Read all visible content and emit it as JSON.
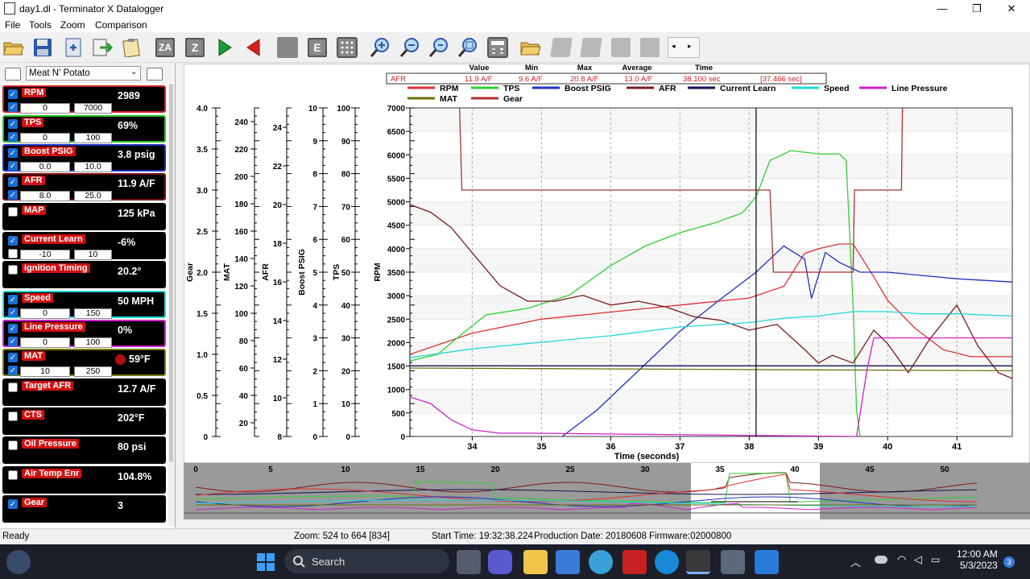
{
  "window": {
    "title": "day1.dl - Terminator X Datalogger",
    "minimize": "—",
    "maximize": "❐",
    "close": "✕"
  },
  "menu": [
    {
      "label": "File"
    },
    {
      "label": "Tools"
    },
    {
      "label": "Zoom"
    },
    {
      "label": "Comparison"
    }
  ],
  "toolbar": {
    "za_label": "ZA",
    "z_label": "Z",
    "e_label": "E"
  },
  "profile": {
    "selected": "Meat N' Potato"
  },
  "channels": [
    {
      "label": "RPM",
      "value": "2989",
      "min": "0",
      "max": "7000",
      "checked": true,
      "bordercolor": "#d02020"
    },
    {
      "label": "TPS",
      "value": "69%",
      "min": "0",
      "max": "100",
      "checked": true,
      "bordercolor": "#22c422"
    },
    {
      "label": "Boost PSIG",
      "value": "3.8 psig",
      "min": "0.0",
      "max": "10.0",
      "checked": true,
      "bordercolor": "#2030c0"
    },
    {
      "label": "AFR",
      "value": "11.9 A/F",
      "min": "8.0",
      "max": "25.0",
      "checked": true,
      "bordercolor": "#7a1010"
    },
    {
      "label": "MAP",
      "value": "125 kPa",
      "checked": false,
      "bordercolor": "#000000"
    },
    {
      "label": "Current Learn",
      "value": "-6%",
      "min": "-10",
      "max": "10",
      "checked": true,
      "bordercolor": "#000000"
    },
    {
      "label": "Ignition Timing",
      "value": "20.2°",
      "checked": false,
      "bordercolor": "#000000"
    },
    {
      "label": "Speed",
      "value": "50 MPH",
      "min": "0",
      "max": "150",
      "checked": true,
      "bordercolor": "#20d8d8"
    },
    {
      "label": "Line Pressure",
      "value": "0%",
      "min": "0",
      "max": "100",
      "checked": true,
      "bordercolor": "#d020d0"
    },
    {
      "label": "MAT",
      "value": "59°F",
      "min": "10",
      "max": "250",
      "checked": true,
      "bordercolor": "#7a7a10"
    },
    {
      "label": "Target AFR",
      "value": "12.7 A/F",
      "checked": false,
      "bordercolor": "#000000"
    },
    {
      "label": "CTS",
      "value": "202°F",
      "checked": false,
      "bordercolor": "#000000"
    },
    {
      "label": "Oil Pressure",
      "value": "80 psi",
      "checked": false,
      "bordercolor": "#000000"
    },
    {
      "label": "Air Temp Enr",
      "value": "104.8%",
      "checked": false,
      "bordercolor": "#000000"
    },
    {
      "label": "Gear",
      "value": "3",
      "checked": true,
      "bordercolor": "#000000"
    }
  ],
  "stats": {
    "headers": [
      "Value",
      "Min",
      "Max",
      "Average",
      "Time"
    ],
    "row": {
      "channel": "AFR",
      "value": "11.9 A/F",
      "min": "9.6 A/F",
      "max": "20.8 A/F",
      "average": "13.0 A/F",
      "time": "38.100 sec",
      "extra": "[37.466 sec]"
    }
  },
  "legend": [
    {
      "name": "RPM",
      "color": "#e03030"
    },
    {
      "name": "TPS",
      "color": "#30d030"
    },
    {
      "name": "Boost PSIG",
      "color": "#2030c0"
    },
    {
      "name": "AFR",
      "color": "#7a1a1a"
    },
    {
      "name": "Current Learn",
      "color": "#101050"
    },
    {
      "name": "Speed",
      "color": "#20d8d8"
    },
    {
      "name": "Line Pressure",
      "color": "#d020d0"
    },
    {
      "name": "MAT",
      "color": "#707010"
    },
    {
      "name": "Gear",
      "color": "#b03030"
    }
  ],
  "axes": {
    "gear": {
      "label": "Gear",
      "ticks": [
        "4.0",
        "3.5",
        "3.0",
        "2.5",
        "2.0",
        "1.5",
        "1.0",
        "0.5",
        "0"
      ]
    },
    "mat": {
      "label": "MAT",
      "ticks": [
        "240",
        "220",
        "200",
        "180",
        "160",
        "140",
        "120",
        "100",
        "80",
        "60",
        "40",
        "20"
      ]
    },
    "afr": {
      "label": "AFR",
      "ticks": [
        "24",
        "22",
        "20",
        "18",
        "16",
        "14",
        "12",
        "10",
        "8"
      ]
    },
    "boost": {
      "label": "Boost PSIG",
      "ticks": [
        "10",
        "9",
        "8",
        "7",
        "6",
        "5",
        "4",
        "3",
        "2",
        "1",
        "0"
      ]
    },
    "tps": {
      "label": "TPS",
      "ticks": [
        "100",
        "90",
        "80",
        "70",
        "60",
        "50",
        "40",
        "30",
        "20",
        "10",
        "0"
      ]
    },
    "rpm": {
      "label": "RPM",
      "ticks": [
        "7000",
        "6500",
        "6000",
        "5500",
        "5000",
        "4500",
        "4000",
        "3500",
        "3000",
        "2500",
        "2000",
        "1500",
        "1000",
        "500",
        "0"
      ]
    },
    "time": {
      "label": "Time (seconds)",
      "ticks": [
        "34",
        "35",
        "36",
        "37",
        "38",
        "39",
        "40",
        "41"
      ]
    }
  },
  "chart_data": {
    "type": "line",
    "xlabel": "Time (seconds)",
    "xlim": [
      33.1,
      41.8
    ],
    "cursor_x": 38.1,
    "series": [
      {
        "name": "RPM",
        "color": "#e03030",
        "units": "RPM",
        "ylim": [
          0,
          7000
        ],
        "x": [
          33.1,
          34,
          35,
          36,
          37,
          38,
          38.5,
          38.8,
          39,
          39.3,
          39.5,
          39.8,
          40,
          40.4,
          40.8,
          41.2,
          41.8
        ],
        "y": [
          1750,
          2200,
          2500,
          2650,
          2800,
          2950,
          3200,
          3900,
          4000,
          4100,
          4100,
          3400,
          2900,
          2300,
          1850,
          1700,
          1700
        ]
      },
      {
        "name": "TPS",
        "color": "#30d030",
        "units": "%",
        "ylim": [
          0,
          100
        ],
        "x": [
          33.1,
          33.5,
          33.9,
          34.2,
          34.8,
          35.4,
          36,
          36.5,
          37,
          37.5,
          37.9,
          38.1,
          38.3,
          38.6,
          39,
          39.3,
          39.4,
          39.5,
          39.55,
          39.6
        ],
        "y": [
          23,
          25,
          32,
          37,
          39,
          43,
          52,
          58,
          62,
          65,
          68,
          73,
          84,
          87,
          86,
          86,
          84,
          40,
          8,
          0
        ]
      },
      {
        "name": "Boost PSIG",
        "color": "#2030c0",
        "units": "psig",
        "ylim": [
          0,
          10
        ],
        "x": [
          35.3,
          35.8,
          36.4,
          37,
          37.6,
          38.1,
          38.5,
          38.8,
          38.9,
          39.1,
          39.3,
          39.5,
          39.6,
          40,
          40.5,
          41,
          41.8
        ],
        "y": [
          0,
          0.8,
          2.0,
          3.2,
          4.2,
          5.0,
          5.8,
          5.4,
          4.2,
          5.6,
          5.3,
          5.1,
          5.0,
          5.0,
          4.9,
          4.8,
          4.7
        ]
      },
      {
        "name": "AFR",
        "color": "#7a1a1a",
        "units": "A/F",
        "ylim": [
          8,
          25
        ],
        "x": [
          33.1,
          33.4,
          33.7,
          34,
          34.4,
          34.8,
          35.2,
          35.6,
          36,
          36.4,
          36.8,
          37.2,
          37.6,
          38,
          38.4,
          38.8,
          39,
          39.2,
          39.5,
          39.8,
          40,
          40.3,
          40.6,
          41,
          41.3,
          41.6,
          41.8
        ],
        "y": [
          20,
          19.6,
          18.8,
          17.5,
          15.8,
          15,
          15,
          15.3,
          14.8,
          15,
          14.7,
          14.2,
          14,
          13.5,
          13.8,
          12.5,
          11.8,
          12.2,
          11.8,
          13.5,
          12.8,
          11.3,
          13,
          14.8,
          12.7,
          11.3,
          11
        ]
      },
      {
        "name": "Current Learn",
        "color": "#101050",
        "units": "%",
        "ylim": [
          -10,
          10
        ],
        "x": [
          33.1,
          41.8
        ],
        "y": [
          -5.7,
          -5.7
        ]
      },
      {
        "name": "Speed",
        "color": "#20d8d8",
        "units": "MPH",
        "ylim": [
          0,
          150
        ],
        "x": [
          33.1,
          34,
          35,
          36,
          37,
          38,
          38.5,
          39,
          39.5,
          40,
          40.5,
          41,
          41.8
        ],
        "y": [
          36,
          40,
          43,
          46,
          50,
          52,
          54,
          55,
          57,
          57,
          56,
          56,
          55
        ]
      },
      {
        "name": "Line Pressure",
        "color": "#d020d0",
        "units": "%",
        "ylim": [
          0,
          100
        ],
        "x": [
          33.1,
          33.4,
          33.7,
          34,
          34.4,
          34.8,
          39.55,
          39.7,
          39.8,
          41.8
        ],
        "y": [
          12,
          10,
          5,
          2,
          1,
          1,
          0,
          20,
          30,
          30
        ]
      },
      {
        "name": "MAT",
        "color": "#707010",
        "units": "°F",
        "ylim": [
          10,
          250
        ],
        "x": [
          33.1,
          41.8
        ],
        "y": [
          60,
          58
        ]
      },
      {
        "name": "Gear",
        "color": "#b03030",
        "units": "",
        "ylim": [
          0,
          4
        ],
        "x": [
          33.1,
          33.8,
          33.85,
          38.3,
          38.35,
          39.5,
          39.52,
          40.2,
          40.22,
          41.8
        ],
        "y": [
          4.5,
          4.5,
          3,
          3,
          2,
          2,
          3,
          3,
          4.5,
          4.5
        ]
      }
    ]
  },
  "overview": {
    "ticks": [
      "0",
      "5",
      "10",
      "15",
      "20",
      "25",
      "30",
      "35",
      "40",
      "45",
      "50"
    ]
  },
  "status": {
    "ready": "Ready",
    "zoom": "Zoom: 524 to 664 [834]",
    "start_time": "Start Time: 19:32:38.224",
    "production_date": "Production Date: 20180608",
    "firmware": "Firmware:02000800"
  },
  "taskbar": {
    "search": "Search",
    "time": "12:00 AM",
    "date": "5/3/2023",
    "badge": "3"
  }
}
